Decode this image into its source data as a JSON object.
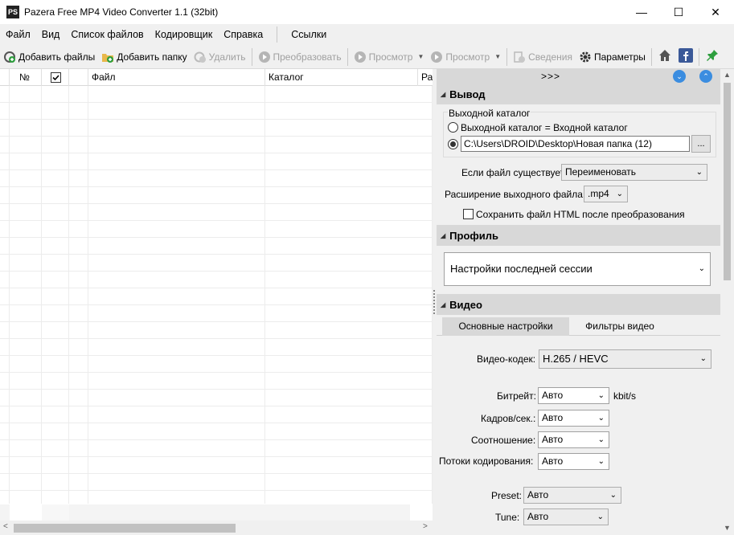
{
  "window": {
    "title": "Pazera Free MP4 Video Converter 1.1 (32bit)",
    "icon_text": "PS",
    "minimize": "—",
    "maximize": "☐",
    "close": "✕"
  },
  "menu": {
    "items": [
      "Файл",
      "Вид",
      "Список файлов",
      "Кодировщик",
      "Справка"
    ],
    "links": "Ссылки"
  },
  "toolbar": {
    "add_files": "Добавить файлы",
    "add_folder": "Добавить папку",
    "remove": "Удалить",
    "convert": "Преобразовать",
    "preview1": "Просмотр",
    "preview2": "Просмотр",
    "info": "Сведения",
    "settings": "Параметры"
  },
  "grid": {
    "col_num": "№",
    "col_file": "Файл",
    "col_dir": "Каталог",
    "col_extra": "Ра"
  },
  "panel": {
    "expand": ">>>",
    "output": {
      "title": "Вывод",
      "group_label": "Выходной каталог",
      "radio_same": "Выходной каталог = Входной каталог",
      "path": "C:\\Users\\DROID\\Desktop\\Новая папка (12)",
      "browse": "...",
      "if_exists_label": "Если файл существует:",
      "if_exists_value": "Переименовать",
      "ext_label": "Расширение выходного файла:",
      "ext_value": ".mp4",
      "save_html": "Сохранить файл HTML после преобразования"
    },
    "profile": {
      "title": "Профиль",
      "value": "Настройки последней сессии"
    },
    "video": {
      "title": "Видео",
      "tab_basic": "Основные настройки",
      "tab_filters": "Фильтры видео",
      "codec_label": "Видео-кодек:",
      "codec_value": "H.265 / HEVC",
      "bitrate_label": "Битрейт:",
      "bitrate_value": "Авто",
      "bitrate_unit": "kbit/s",
      "fps_label": "Кадров/сек.:",
      "fps_value": "Авто",
      "aspect_label": "Соотношение:",
      "aspect_value": "Авто",
      "threads_label": "Потоки кодирования:",
      "threads_value": "Авто",
      "preset_label": "Preset:",
      "preset_value": "Авто",
      "tune_label": "Tune:",
      "tune_value": "Авто"
    }
  }
}
